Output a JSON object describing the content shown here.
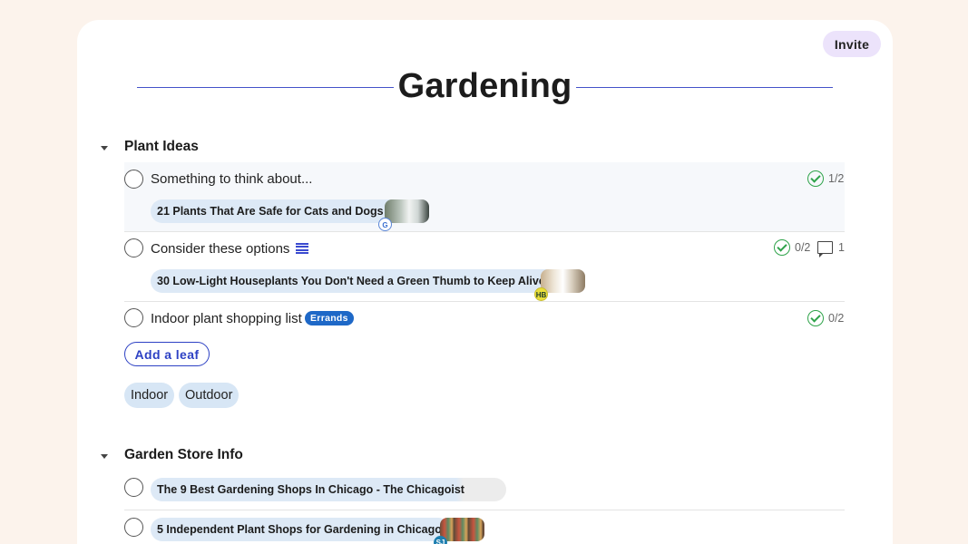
{
  "header": {
    "invite_label": "Invite",
    "title": "Gardening"
  },
  "colors": {
    "accent": "#2d41c4",
    "done": "#2fa34a",
    "badge": "#1e68c7",
    "pill": "#dde9f6",
    "background": "#fcf3ec"
  },
  "sections": [
    {
      "title": "Plant Ideas",
      "items": [
        {
          "text": "Something to think about...",
          "progress": "1/2",
          "link": {
            "title": "21 Plants That Are Safe for Cats and Dogs",
            "favicon": "google-icon"
          }
        },
        {
          "text": "Consider these options",
          "notes_icon": "notes-icon",
          "progress": "0/2",
          "comments": "1",
          "link": {
            "title": "30 Low-Light Houseplants You Don't Need a Green Thumb to Keep Alive",
            "favicon": "HB"
          }
        },
        {
          "text": "Indoor plant shopping list",
          "badge": "Errands",
          "progress": "0/2"
        }
      ],
      "add_label": "Add a leaf",
      "tags": [
        "Indoor",
        "Outdoor"
      ]
    },
    {
      "title": "Garden Store Info",
      "items": [
        {
          "link": {
            "title": "The 9 Best Gardening Shops In Chicago - The Chicagoist"
          }
        },
        {
          "link": {
            "title": "5 Independent Plant Shops for Gardening in Chicago",
            "favicon": "SJ"
          }
        }
      ]
    }
  ]
}
